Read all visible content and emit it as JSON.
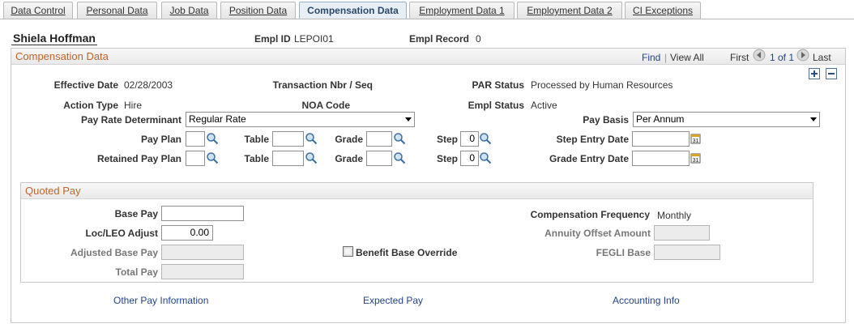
{
  "tabs": [
    {
      "label": "Data Control"
    },
    {
      "label": "Personal Data"
    },
    {
      "label": "Job Data"
    },
    {
      "label": "Position Data"
    },
    {
      "label": "Compensation Data"
    },
    {
      "label": "Employment Data 1"
    },
    {
      "label": "Employment Data 2"
    },
    {
      "label": "CI Exceptions"
    }
  ],
  "employee": {
    "name": "Shiela Hoffman",
    "empl_id_label": "Empl ID",
    "empl_id": "LEPOI01",
    "empl_record_label": "Empl Record",
    "empl_record": "0"
  },
  "section": {
    "title": "Compensation Data",
    "find": "Find",
    "view_all": "View All",
    "first": "First",
    "range": "1 of 1",
    "last": "Last"
  },
  "fields": {
    "effective_date_label": "Effective Date",
    "effective_date": "02/28/2003",
    "transaction_label": "Transaction Nbr / Seq",
    "par_status_label": "PAR Status",
    "par_status": "Processed by Human Resources",
    "action_type_label": "Action Type",
    "action_type": "Hire",
    "noa_code_label": "NOA Code",
    "empl_status_label": "Empl Status",
    "empl_status": "Active",
    "pay_rate_label": "Pay Rate Determinant",
    "pay_rate_value": "Regular Rate",
    "pay_basis_label": "Pay Basis",
    "pay_basis_value": "Per Annum",
    "pay_plan_label": "Pay Plan",
    "table_label": "Table",
    "grade_label": "Grade",
    "step_label": "Step",
    "step_value": "0",
    "step_entry_date_label": "Step Entry Date",
    "retained_pay_plan_label": "Retained Pay Plan",
    "retained_table_label": "Table",
    "retained_grade_label": "Grade",
    "retained_step_label": "Step",
    "retained_step_value": "0",
    "grade_entry_date_label": "Grade Entry Date"
  },
  "quoted_pay": {
    "title": "Quoted Pay",
    "base_pay_label": "Base Pay",
    "base_pay": "",
    "loc_leo_label": "Loc/LEO Adjust",
    "loc_leo": "0.00",
    "adjusted_base_label": "Adjusted Base Pay",
    "total_pay_label": "Total Pay",
    "benefit_base_label": "Benefit Base Override",
    "comp_freq_label": "Compensation Frequency",
    "comp_freq": "Monthly",
    "annuity_label": "Annuity Offset Amount",
    "fegli_label": "FEGLI Base"
  },
  "links": {
    "other_pay": "Other Pay Information",
    "expected_pay": "Expected Pay",
    "accounting": "Accounting Info"
  },
  "colors": {
    "accent": "#c0642a",
    "link": "#224488",
    "active_tab": "#2b4a6b"
  },
  "icons": [
    "search-icon",
    "calendar-icon",
    "prev-arrow-icon",
    "next-arrow-icon",
    "add-row-icon",
    "delete-row-icon",
    "dropdown-arrow-icon",
    "checkbox"
  ]
}
